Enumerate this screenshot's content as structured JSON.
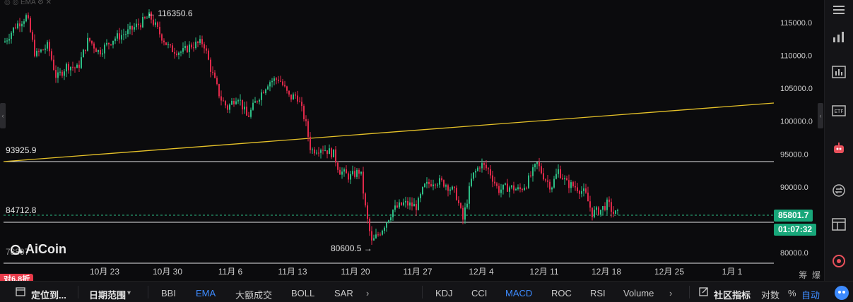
{
  "legend": {
    "label": "EMA"
  },
  "price_axis": {
    "ticks": [
      "115000.0",
      "110000.0",
      "105000.0",
      "100000.0",
      "95000.0",
      "90000.0",
      "80000.0"
    ]
  },
  "time_axis": {
    "ticks": [
      "10月 23",
      "10月 30",
      "11月 6",
      "11月 13",
      "11月 20",
      "11月 27",
      "12月 4",
      "12月 11",
      "12月 18",
      "12月 25",
      "1月 1"
    ]
  },
  "annotations": {
    "high_label": "← 116350.6",
    "low_label": "80600.5 →",
    "level_93925": "93925.9",
    "level_84712": "84712.8",
    "level_bottom": "78807"
  },
  "current_price": {
    "value": "85801.7",
    "countdown": "01:07:32"
  },
  "right_toolbar": {
    "corner_labels": [
      "筹",
      "爆"
    ],
    "icons": [
      "menu-icon",
      "bar-chart-icon",
      "indicator-panel-icon",
      "etf-icon",
      "robot-icon",
      "exchange-icon",
      "layout-icon",
      "notification-icon"
    ]
  },
  "bottom_bar": {
    "locate": "定位到...",
    "date_range": "日期范围",
    "main_indicators": [
      "BBI",
      "EMA",
      "大额成交",
      "BOLL",
      "SAR"
    ],
    "sub_indicators": [
      "KDJ",
      "CCI",
      "MACD",
      "ROC",
      "RSI",
      "Volume"
    ],
    "community": "社区指标",
    "log_label": "对数",
    "percent_label": "%",
    "auto_label": "自动"
  },
  "badge": "对6.8折",
  "brand": "AiCoin",
  "colors": {
    "up": "#2ebd85",
    "down": "#e0294a",
    "trendline": "#e6c229",
    "accent": "#3d8bff",
    "price_tag": "#18a77a"
  }
}
